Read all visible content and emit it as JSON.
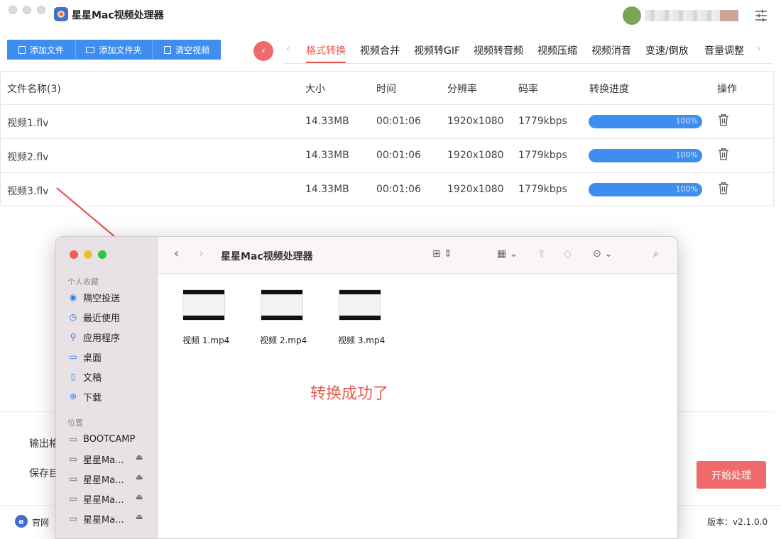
{
  "app": {
    "title": "星星Mac视频处理器",
    "accent": "#3d8eef",
    "brand_red": "#ef6b6b"
  },
  "toolbar": {
    "add_file": "添加文件",
    "add_folder": "添加文件夹",
    "clear_video": "清空视频"
  },
  "tabs": [
    {
      "label": "格式转换",
      "active": true
    },
    {
      "label": "视频合并"
    },
    {
      "label": "视频转GIF"
    },
    {
      "label": "视频转音频"
    },
    {
      "label": "视频压缩"
    },
    {
      "label": "视频消音"
    },
    {
      "label": "变速/倒放"
    },
    {
      "label": "音量调整"
    }
  ],
  "table": {
    "headers": {
      "name": "文件名称(3)",
      "size": "大小",
      "time": "时间",
      "resolution": "分辨率",
      "bitrate": "码率",
      "progress": "转换进度",
      "action": "操作"
    },
    "rows": [
      {
        "name": "视频1.flv",
        "size": "14.33MB",
        "time": "00:01:06",
        "resolution": "1920x1080",
        "bitrate": "1779kbps",
        "progress": "100%"
      },
      {
        "name": "视频2.flv",
        "size": "14.33MB",
        "time": "00:01:06",
        "resolution": "1920x1080",
        "bitrate": "1779kbps",
        "progress": "100%"
      },
      {
        "name": "视频3.flv",
        "size": "14.33MB",
        "time": "00:01:06",
        "resolution": "1920x1080",
        "bitrate": "1779kbps",
        "progress": "100%"
      }
    ]
  },
  "bottom": {
    "output_label": "输出格",
    "save_label": "保存目",
    "start_button": "开始处理"
  },
  "footer": {
    "site_label": "官网",
    "version": "版本：v2.1.0.0"
  },
  "finder": {
    "title": "星星Mac视频处理器",
    "favorites_header": "个人收藏",
    "favorites": [
      {
        "label": "隔空投送",
        "icon": "airdrop-icon"
      },
      {
        "label": "最近使用",
        "icon": "clock-icon"
      },
      {
        "label": "应用程序",
        "icon": "apps-icon"
      },
      {
        "label": "桌面",
        "icon": "desktop-icon"
      },
      {
        "label": "文稿",
        "icon": "document-icon"
      },
      {
        "label": "下载",
        "icon": "download-icon"
      }
    ],
    "locations_header": "位置",
    "locations": [
      {
        "label": "BOOTCAMP"
      },
      {
        "label": "星星Ma..."
      },
      {
        "label": "星星Ma..."
      },
      {
        "label": "星星Ma..."
      },
      {
        "label": "星星Ma..."
      }
    ],
    "files": [
      {
        "label": "视频 1.mp4"
      },
      {
        "label": "视频 2.mp4"
      },
      {
        "label": "视频 3.mp4"
      }
    ]
  },
  "annotation": {
    "text": "转换成功了",
    "color": "#e8584d"
  }
}
